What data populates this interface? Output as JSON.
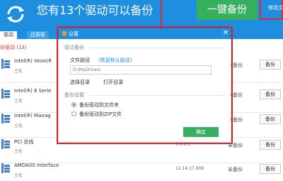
{
  "header": {
    "headline": "您有13个驱动可以备份",
    "backup_button": "一键备份",
    "side_link": "修改文",
    "colors": {
      "header": "#1e8fe0",
      "button": "#36b05f",
      "highlight": "#e8272f"
    }
  },
  "tabs": [
    {
      "label": "驱动"
    },
    {
      "label": "还原驱"
    }
  ],
  "section_title": "份驱动 (13)",
  "rows": [
    {
      "name": "Intel(R) Xeon(R",
      "category": "主板",
      "version": "",
      "status": "未备份",
      "button": "备份",
      "icon": "chip-icon"
    },
    {
      "name": "Intel(R) 8 Serie",
      "category": "主板",
      "version": "",
      "status": "未备份",
      "button": "备份",
      "icon": "chip-icon"
    },
    {
      "name": "Intel(R) Manag",
      "category": "主板",
      "version": "",
      "status": "未备份",
      "button": "备份",
      "icon": "chip-icon"
    },
    {
      "name": "PCI 总线",
      "category": "主板",
      "version": "6.0.6.1",
      "status": "未备份",
      "button": "备份",
      "icon": "chip-icon"
    },
    {
      "name": "AMDA00 Interface",
      "category": "主板",
      "version": "12.14.17.909",
      "status": "未备份",
      "button": "备份",
      "icon": "chip-icon"
    }
  ],
  "dialog": {
    "title": "设置",
    "close_icon": "close-icon",
    "backup_group_label": "驱动备份",
    "path_label": "文件路径",
    "restore_default": "(恢复默认路径)",
    "path_placeholder": "D:\\MyDrivers",
    "select_dir": "选择目录",
    "open_dir": "打开目录",
    "settings_group_label": "备份设置",
    "options": [
      {
        "label": "备份驱动到文件夹",
        "selected": true
      },
      {
        "label": "备份驱动到ZIP文件",
        "selected": false
      }
    ],
    "confirm": "确定"
  }
}
